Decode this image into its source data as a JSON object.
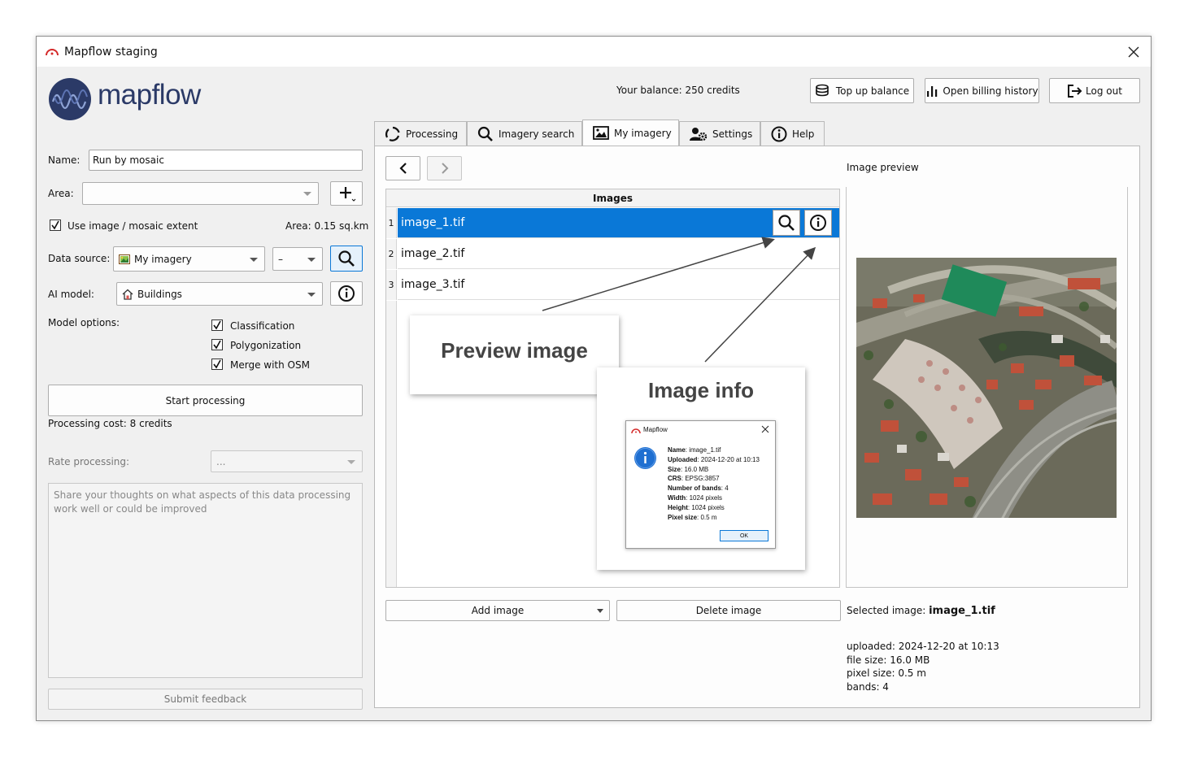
{
  "window": {
    "title": "Mapflow staging"
  },
  "header": {
    "logo_text": "mapflow",
    "balance": "Your balance: 250 credits",
    "top_up_label": "Top up balance",
    "billing_label": "Open billing history",
    "logout_label": "Log out"
  },
  "left": {
    "name_label": "Name:",
    "name_value": "Run by mosaic",
    "area_label": "Area:",
    "area_value": "",
    "use_extent_label": "Use image / mosaic extent",
    "use_extent_checked": true,
    "area_size": "Area: 0.15 sq.km",
    "data_source_label": "Data source:",
    "data_source_value": "My imagery",
    "data_source_sub_value": "–",
    "ai_model_label": "AI model:",
    "ai_model_value": "Buildings",
    "model_options_label": "Model options:",
    "options": [
      {
        "label": "Classification",
        "checked": true
      },
      {
        "label": "Polygonization",
        "checked": true
      },
      {
        "label": "Merge with OSM",
        "checked": true
      }
    ],
    "start_label": "Start processing",
    "cost": "Processing cost: 8 credits",
    "rate_label": "Rate processing:",
    "rate_value": "...",
    "feedback_placeholder": "Share your thoughts on what aspects of this data processing work well or could be improved",
    "submit_label": "Submit feedback"
  },
  "tabs": [
    {
      "label": "Processing",
      "icon": "processing-icon"
    },
    {
      "label": "Imagery search",
      "icon": "search-icon"
    },
    {
      "label": "My imagery",
      "icon": "image-icon",
      "active": true
    },
    {
      "label": "Settings",
      "icon": "settings-icon"
    },
    {
      "label": "Help",
      "icon": "info-icon"
    }
  ],
  "imagery": {
    "table_header": "Images",
    "rows": [
      {
        "num": "1",
        "name": "image_1.tif",
        "selected": true
      },
      {
        "num": "2",
        "name": "image_2.tif"
      },
      {
        "num": "3",
        "name": "image_3.tif"
      }
    ],
    "add_label": "Add image",
    "delete_label": "Delete image",
    "preview_label": "Image preview",
    "selected_prefix": "Selected image:",
    "selected_name": "image_1.tif",
    "details": [
      "uploaded: 2024-12-20 at 10:13",
      "file size: 16.0 MB",
      "pixel size: 0.5 m",
      "bands: 4"
    ]
  },
  "callouts": {
    "preview": "Preview image",
    "info": "Image info"
  },
  "info_dialog": {
    "title": "Mapflow",
    "lines": [
      {
        "key": "Name",
        "value": ": image_1.tif"
      },
      {
        "key": "Uploaded",
        "value": ": 2024-12-20 at 10:13"
      },
      {
        "key": "Size",
        "value": ": 16.0 MB"
      },
      {
        "key": "CRS",
        "value": ": EPSG:3857"
      },
      {
        "key": "Number of bands",
        "value": ": 4"
      },
      {
        "key": "Width",
        "value": ": 1024 pixels"
      },
      {
        "key": "Height",
        "value": ": 1024 pixels"
      },
      {
        "key": "Pixel size",
        "value": ": 0.5 m"
      }
    ],
    "ok_label": "OK"
  },
  "colors": {
    "accent": "#0a78d7",
    "logo": "#2b3a67",
    "window_bg": "#f0f0f0"
  }
}
